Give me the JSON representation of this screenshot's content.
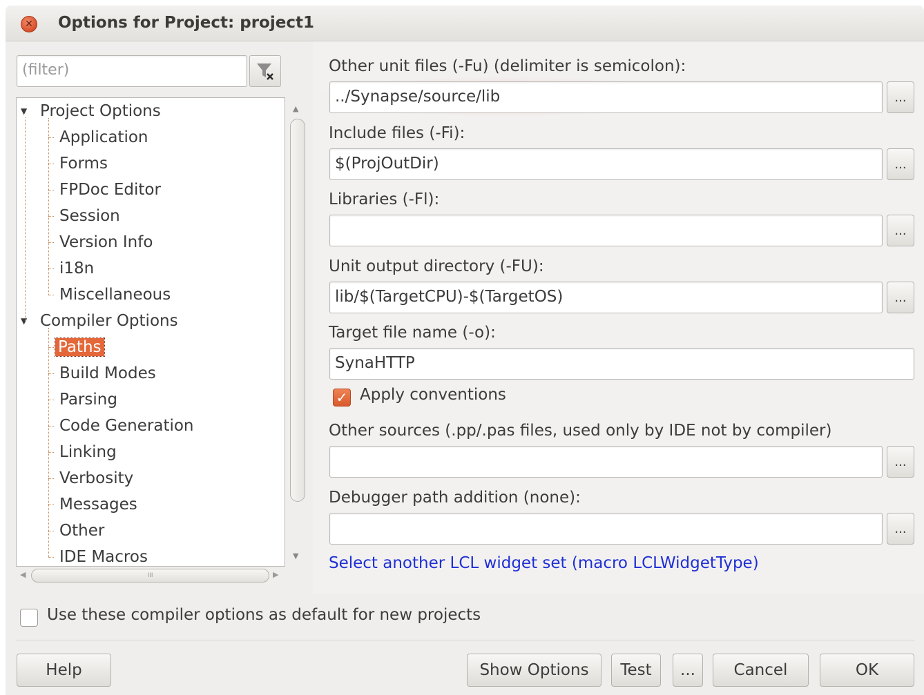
{
  "window": {
    "title": "Options for Project: project1"
  },
  "filter": {
    "placeholder": "(filter)"
  },
  "tree": {
    "groups": [
      {
        "label": "Project Options",
        "children": [
          "Application",
          "Forms",
          "FPDoc Editor",
          "Session",
          "Version Info",
          "i18n",
          "Miscellaneous"
        ]
      },
      {
        "label": "Compiler Options",
        "children": [
          "Paths",
          "Build Modes",
          "Parsing",
          "Code Generation",
          "Linking",
          "Verbosity",
          "Messages",
          "Other",
          "IDE Macros"
        ]
      }
    ],
    "selected": "Paths"
  },
  "paths": {
    "fields": [
      {
        "label": "Other unit files (-Fu) (delimiter is semicolon):",
        "value": "../Synapse/source/lib",
        "has_button": true
      },
      {
        "label": "Include files (-Fi):",
        "value": "$(ProjOutDir)",
        "has_button": true
      },
      {
        "label": "Libraries (-Fl):",
        "value": "",
        "has_button": true
      },
      {
        "label": "Unit output directory (-FU):",
        "value": "lib/$(TargetCPU)-$(TargetOS)",
        "has_button": true
      },
      {
        "label": "Target file name (-o):",
        "value": "SynaHTTP",
        "has_button": false
      },
      {
        "label": "Other sources (.pp/.pas files, used only by IDE not by compiler)",
        "value": "",
        "has_button": true
      },
      {
        "label": "Debugger path addition (none):",
        "value": "",
        "has_button": true
      }
    ],
    "apply_conventions": {
      "label": "Apply conventions",
      "checked": true
    },
    "link": "Select another LCL widget set (macro LCLWidgetType)",
    "browse_label": "..."
  },
  "default_option": {
    "label": "Use these compiler options as default for new projects",
    "checked": false
  },
  "buttons": {
    "help": "Help",
    "show_options": "Show Options",
    "test": "Test",
    "more": "...",
    "cancel": "Cancel",
    "ok": "OK"
  },
  "colors": {
    "accent": "#e4673a",
    "link": "#1f2fd6"
  }
}
